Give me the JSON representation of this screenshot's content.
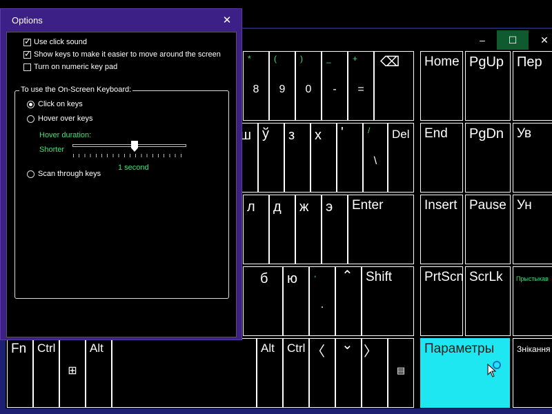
{
  "osk": {
    "titlebar": {
      "minimize_glyph": "–",
      "maximize_glyph": "☐",
      "close_glyph": "✕"
    },
    "keys": {
      "row1": [
        {
          "shift": "*",
          "label": "8"
        },
        {
          "shift": "(",
          "label": "9"
        },
        {
          "shift": ")",
          "label": "0"
        },
        {
          "shift": "_",
          "label": "-"
        },
        {
          "shift": "+",
          "label": "="
        },
        {
          "label": "⌫"
        },
        {
          "label": "Home"
        },
        {
          "label": "PgUp"
        },
        {
          "label": "Пер"
        }
      ],
      "row2": [
        {
          "label": "ш"
        },
        {
          "label": "ў"
        },
        {
          "label": "з"
        },
        {
          "label": "х"
        },
        {
          "label": "'"
        },
        {
          "shift": "/",
          "bottom": "\\"
        },
        {
          "label": "Del"
        },
        {
          "label": "End"
        },
        {
          "label": "PgDn"
        },
        {
          "label": "Ув"
        }
      ],
      "row3": [
        {
          "label": "л"
        },
        {
          "label": "д"
        },
        {
          "label": "ж"
        },
        {
          "label": "э"
        },
        {
          "label": "Enter"
        },
        {
          "label": "Insert"
        },
        {
          "label": "Pause"
        },
        {
          "label": "Ун"
        }
      ],
      "row4": [
        {
          "label": "б"
        },
        {
          "label": "ю"
        },
        {
          "shift": ",",
          "bottom": "."
        },
        {
          "label": "⌃"
        },
        {
          "label": "Shift"
        },
        {
          "label": "PrtScn"
        },
        {
          "label": "ScrLk"
        },
        {
          "label": "Прыстыкав"
        }
      ],
      "row5": [
        {
          "label": "Fn"
        },
        {
          "label": "Ctrl"
        },
        {
          "label": "⊞"
        },
        {
          "label": "Alt"
        },
        {
          "label": "Alt"
        },
        {
          "label": "Ctrl"
        },
        {
          "label": "〈"
        },
        {
          "label": "⌄"
        },
        {
          "label": "〉"
        },
        {
          "label": "▤"
        },
        {
          "label": "Параметры"
        },
        {
          "label": "Знікання"
        }
      ]
    }
  },
  "options": {
    "title": "Options",
    "close_glyph": "✕",
    "use_click_sound": {
      "label": "Use click sound",
      "checked": true
    },
    "show_keys": {
      "label": "Show keys to make it easier to move around the screen",
      "checked": true
    },
    "numeric_keypad": {
      "label": "Turn on numeric key pad",
      "checked": false
    },
    "group_title": "To use the On-Screen Keyboard:",
    "click_on_keys": {
      "label": "Click on keys",
      "selected": true
    },
    "hover_over_keys": {
      "label": "Hover over keys",
      "selected": false
    },
    "hover_duration_label": "Hover duration:",
    "shorter_label": "Shorter",
    "duration_value": "1 second",
    "scan_through_keys": {
      "label": "Scan through keys",
      "selected": false
    }
  },
  "colors": {
    "accent": "#3d2085",
    "key_active": "#1ee7f2",
    "green_text": "#3ee07a",
    "frame_blue": "#1c1f72"
  }
}
